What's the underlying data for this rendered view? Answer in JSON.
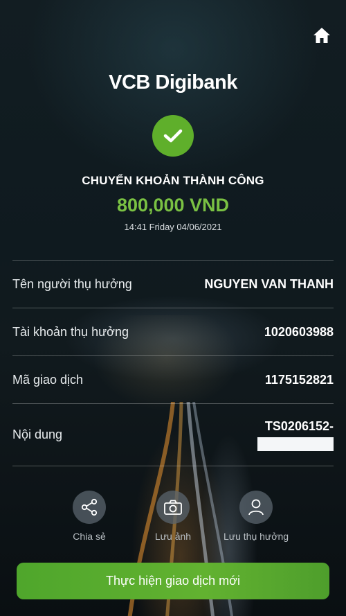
{
  "header": {
    "brand": "VCB Digibank",
    "home_icon": "home-icon"
  },
  "result": {
    "check_icon": "check-icon",
    "status": "CHUYỂN KHOẢN THÀNH CÔNG",
    "amount": "800,000 VND",
    "timestamp": "14:41 Friday 04/06/2021"
  },
  "details": [
    {
      "label": "Tên người thụ hưởng",
      "value": "NGUYEN VAN THANH"
    },
    {
      "label": "Tài khoản thụ hưởng",
      "value": "1020603988"
    },
    {
      "label": "Mã giao dịch",
      "value": "1175152821"
    },
    {
      "label": "Nội dung",
      "value": "TS0206152-"
    }
  ],
  "actions": [
    {
      "label": "Chia sẻ",
      "icon": "share-icon"
    },
    {
      "label": "Lưu ảnh",
      "icon": "camera-icon"
    },
    {
      "label": "Lưu thụ hưởng",
      "icon": "user-icon"
    }
  ],
  "cta": {
    "label": "Thực hiện giao dịch mới"
  },
  "colors": {
    "accent": "#5faf2b",
    "amount": "#7ac143"
  }
}
